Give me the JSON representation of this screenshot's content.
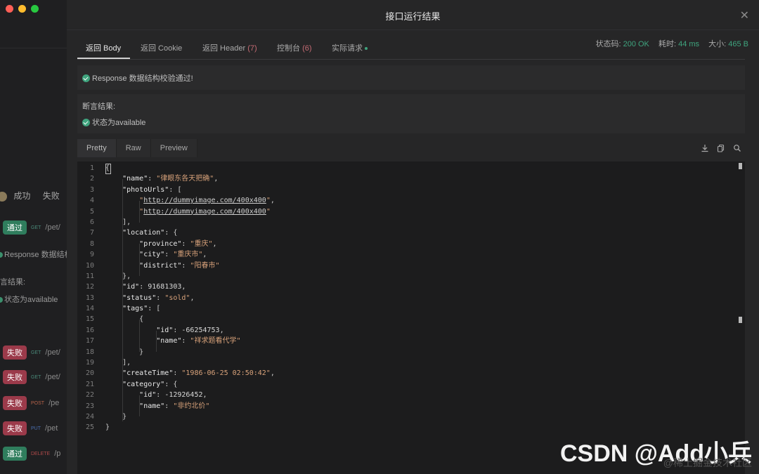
{
  "background": {
    "filters": {
      "pass": "成功",
      "fail": "失败"
    },
    "rows": [
      {
        "status": "通过",
        "method": "GET",
        "path": "/pet/",
        "kind": "pass"
      },
      {
        "status": "失败",
        "method": "GET",
        "path": "/pet/",
        "kind": "fail"
      },
      {
        "status": "失败",
        "method": "GET",
        "path": "/pet/",
        "kind": "fail"
      },
      {
        "status": "失败",
        "method": "POST",
        "path": "/pe",
        "kind": "fail"
      },
      {
        "status": "失败",
        "method": "PUT",
        "path": "/pet",
        "kind": "fail"
      },
      {
        "status": "通过",
        "method": "DELETE",
        "path": "/p",
        "kind": "pass"
      }
    ],
    "response_text": "Response 数据结构",
    "assert_label": "言结果:",
    "assert_item": "状态为available"
  },
  "modal": {
    "title": "接口运行结果",
    "tabs": [
      {
        "label": "返回 Body"
      },
      {
        "label": "返回 Cookie"
      },
      {
        "label": "返回 Header",
        "count": "(7)"
      },
      {
        "label": "控制台",
        "count": "(6)"
      },
      {
        "label": "实际请求"
      }
    ],
    "stats": {
      "status_label": "状态码:",
      "status_value": "200 OK",
      "time_label": "耗时:",
      "time_value": "44 ms",
      "size_label": "大小:",
      "size_value": "465 B"
    },
    "validation_text": "Response 数据结构校验通过!",
    "assert_title": "断言结果:",
    "assert_item": "状态为available",
    "view_tabs": [
      "Pretty",
      "Raw",
      "Preview"
    ]
  },
  "code_lines": [
    "{",
    "    \"name\": \"律眼东各天把确\",",
    "    \"photoUrls\": [",
    "        \"http://dummyimage.com/400x400\",",
    "        \"http://dummyimage.com/400x400\"",
    "    ],",
    "    \"location\": {",
    "        \"province\": \"重庆\",",
    "        \"city\": \"重庆市\",",
    "        \"district\": \"阳春市\"",
    "    },",
    "    \"id\": 91681303,",
    "    \"status\": \"sold\",",
    "    \"tags\": [",
    "        {",
    "            \"id\": -66254753,",
    "            \"name\": \"祥求题看代学\"",
    "        }",
    "    ],",
    "    \"createTime\": \"1986-06-25 02:50:42\",",
    "    \"category\": {",
    "        \"id\": -12926452,",
    "        \"name\": \"非约北价\"",
    "    }",
    "}"
  ],
  "watermark": {
    "main": "CSDN @Add小兵",
    "sub": "@稀土掘金技术社区"
  }
}
